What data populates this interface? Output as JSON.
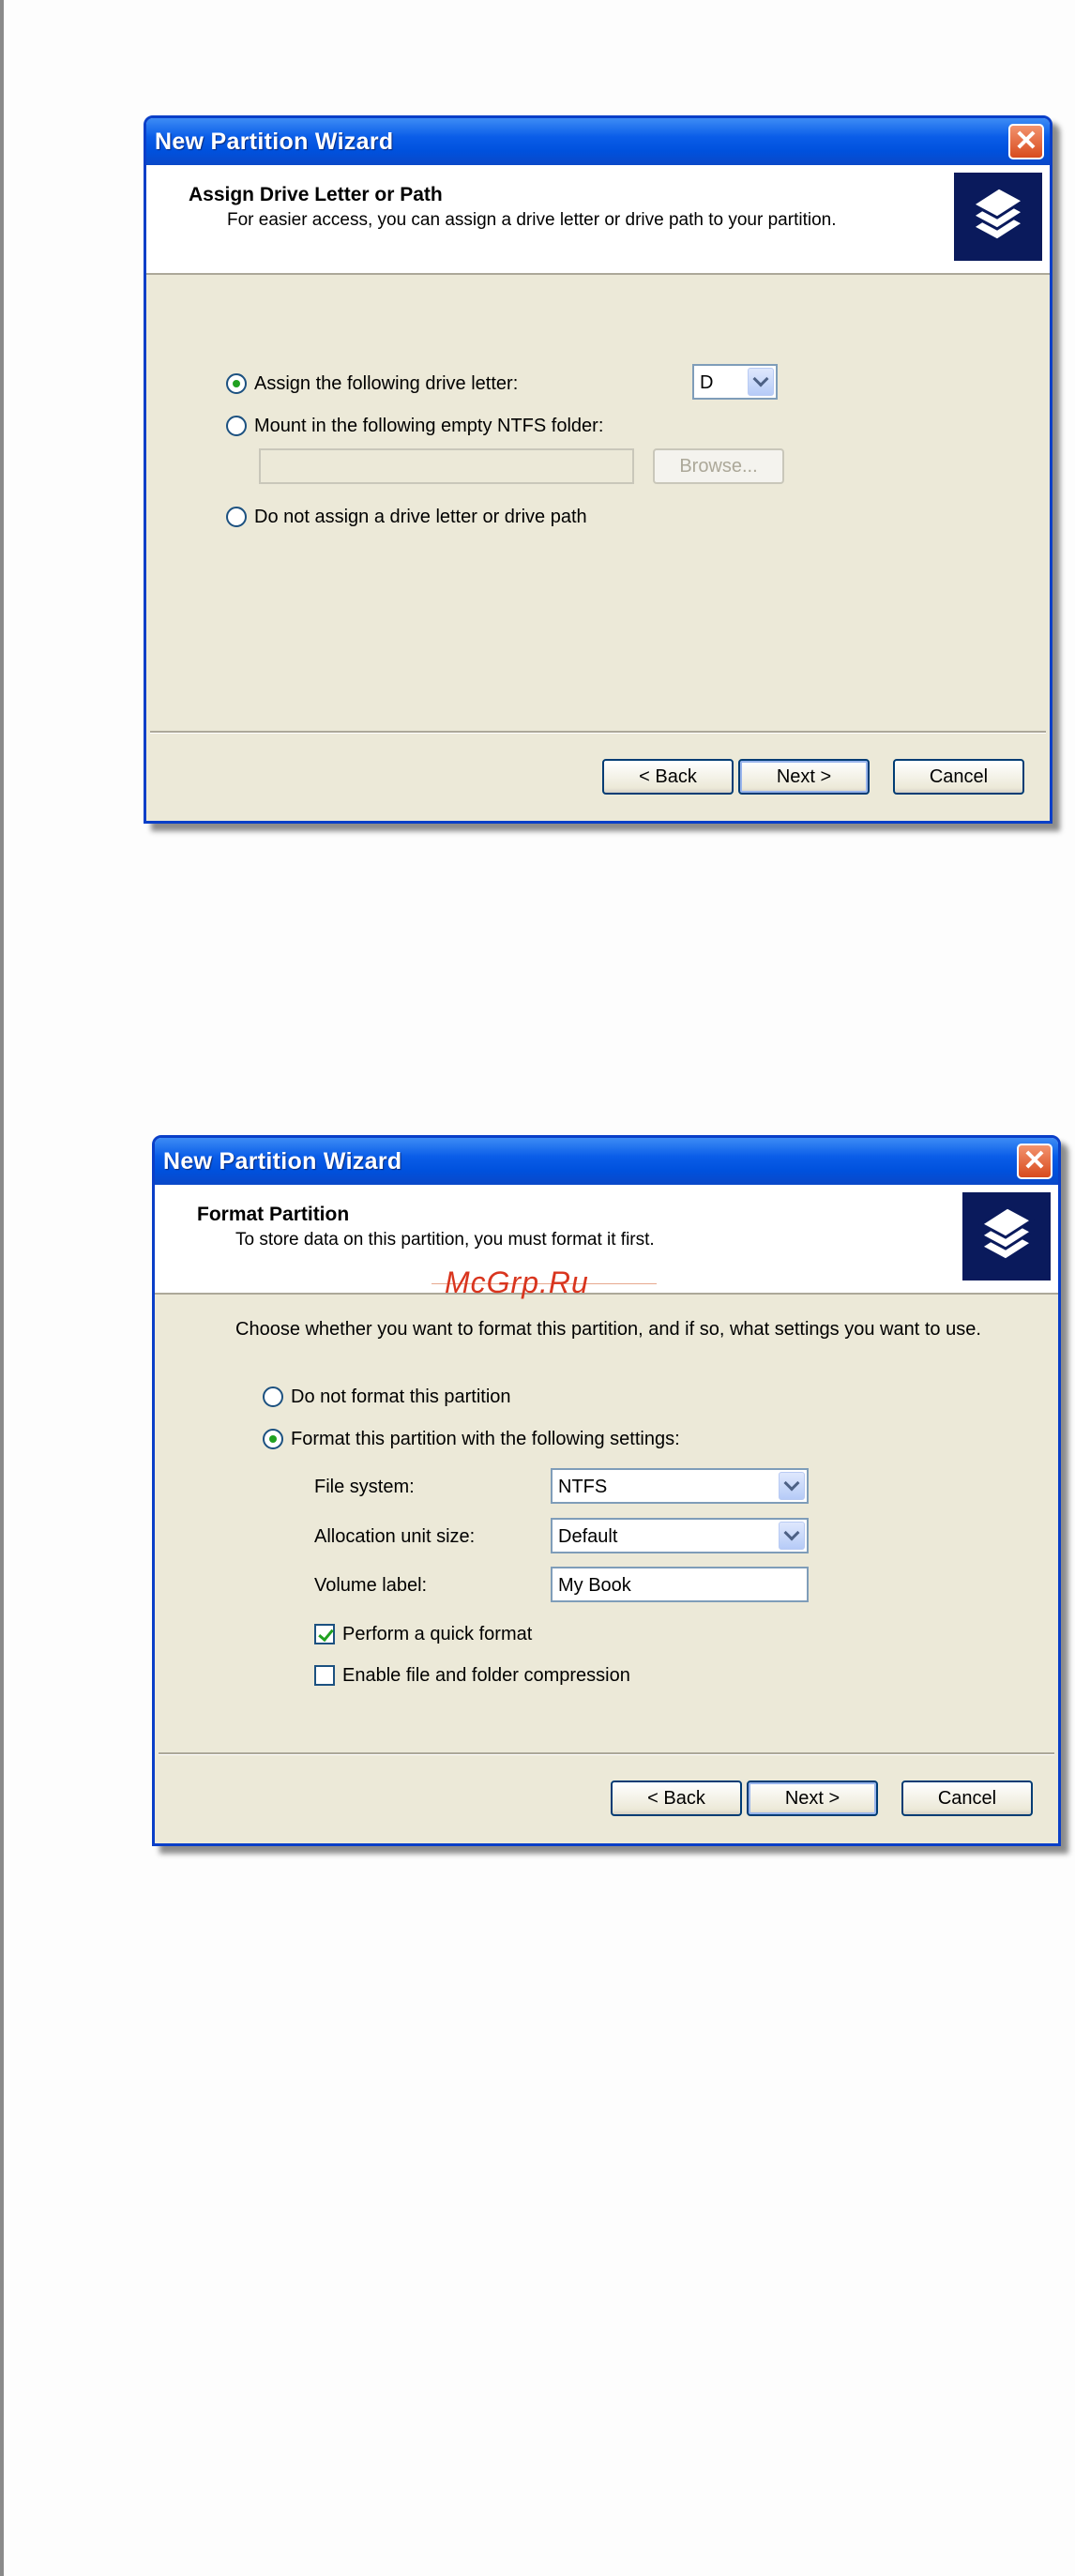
{
  "watermark": "McGrp.Ru",
  "dialog1": {
    "title": "New Partition Wizard",
    "close_icon": "close-icon",
    "header_title": "Assign Drive Letter or Path",
    "header_subtitle": "For easier access, you can assign a drive letter or drive path to your partition.",
    "options": {
      "assign_letter": "Assign the following drive letter:",
      "mount_folder": "Mount in the following empty NTFS folder:",
      "no_assign": "Do not assign a drive letter or drive path"
    },
    "drive_letter_value": "D",
    "folder_path_value": "",
    "browse_label": "Browse...",
    "back_label": "< Back",
    "next_label": "Next >",
    "cancel_label": "Cancel"
  },
  "dialog2": {
    "title": "New Partition Wizard",
    "close_icon": "close-icon",
    "header_title": "Format Partition",
    "header_subtitle": "To store data on this partition, you must format it first.",
    "instruction": "Choose whether you want to format this partition, and if so, what settings you want to use.",
    "options": {
      "no_format": "Do not format this partition",
      "format_with": "Format this partition with the following settings:"
    },
    "file_system_label": "File system:",
    "file_system_value": "NTFS",
    "alloc_label": "Allocation unit size:",
    "alloc_value": "Default",
    "volume_label_label": "Volume label:",
    "volume_label_value": "My Book",
    "quick_format_label": "Perform a quick format",
    "compression_label": "Enable file and folder compression",
    "back_label": "< Back",
    "next_label": "Next >",
    "cancel_label": "Cancel"
  }
}
